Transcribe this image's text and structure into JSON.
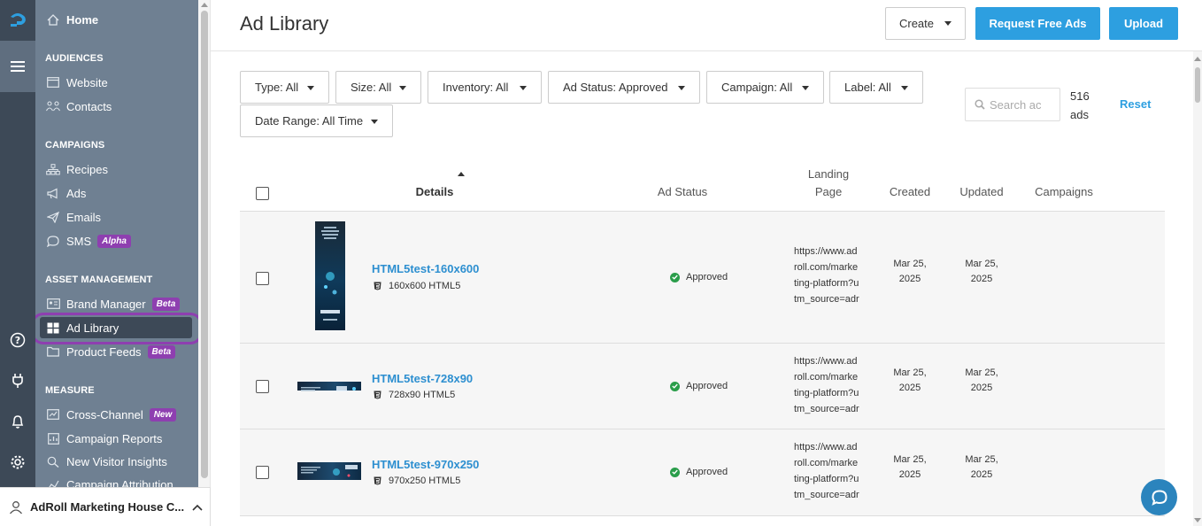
{
  "sidebar": {
    "home": "Home",
    "sections": [
      {
        "title": "AUDIENCES",
        "items": [
          {
            "label": "Website",
            "icon": "browser-icon"
          },
          {
            "label": "Contacts",
            "icon": "contacts-icon"
          }
        ]
      },
      {
        "title": "CAMPAIGNS",
        "items": [
          {
            "label": "Recipes",
            "icon": "recipes-icon"
          },
          {
            "label": "Ads",
            "icon": "megaphone-icon"
          },
          {
            "label": "Emails",
            "icon": "paper-plane-icon"
          },
          {
            "label": "SMS",
            "icon": "chat-bubble-icon",
            "badge": "Alpha"
          }
        ]
      },
      {
        "title": "ASSET MANAGEMENT",
        "items": [
          {
            "label": "Brand Manager",
            "icon": "id-card-icon",
            "badge": "Beta"
          },
          {
            "label": "Ad Library",
            "icon": "grid-icon",
            "active": true
          },
          {
            "label": "Product Feeds",
            "icon": "folder-icon",
            "badge": "Beta"
          }
        ]
      },
      {
        "title": "MEASURE",
        "items": [
          {
            "label": "Cross-Channel",
            "icon": "chart-icon",
            "badge": "New"
          },
          {
            "label": "Campaign Reports",
            "icon": "report-icon"
          },
          {
            "label": "New Visitor Insights",
            "icon": "insights-icon"
          },
          {
            "label": "Campaign Attribution",
            "icon": "attribution-icon"
          }
        ]
      }
    ],
    "account": "AdRoll Marketing House C..."
  },
  "header": {
    "title": "Ad Library",
    "create_label": "Create",
    "request_label": "Request Free Ads",
    "upload_label": "Upload"
  },
  "filters": [
    "Type: All",
    "Size: All",
    "Inventory: All",
    "Ad Status: Approved",
    "Campaign: All",
    "Label: All",
    "Date Range: All Time"
  ],
  "search": {
    "placeholder": "Search ac"
  },
  "ads_count": "516",
  "ads_unit": "ads",
  "reset_label": "Reset",
  "table": {
    "columns": {
      "details": "Details",
      "status": "Ad Status",
      "landing_1": "Landing",
      "landing_2": "Page",
      "created": "Created",
      "updated": "Updated",
      "campaigns": "Campaigns"
    },
    "rows": [
      {
        "name": "HTML5test-160x600",
        "size": "160x600 HTML5",
        "status": "Approved",
        "landing": [
          "https://www.ad",
          "roll.com/marke",
          "ting-platform?u",
          "tm_source=adr"
        ],
        "created": [
          "Mar 25,",
          "2025"
        ],
        "updated": [
          "Mar 25,",
          "2025"
        ]
      },
      {
        "name": "HTML5test-728x90",
        "size": "728x90 HTML5",
        "status": "Approved",
        "landing": [
          "https://www.ad",
          "roll.com/marke",
          "ting-platform?u",
          "tm_source=adr"
        ],
        "created": [
          "Mar 25,",
          "2025"
        ],
        "updated": [
          "Mar 25,",
          "2025"
        ]
      },
      {
        "name": "HTML5test-970x250",
        "size": "970x250 HTML5",
        "status": "Approved",
        "landing": [
          "https://www.ad",
          "roll.com/marke",
          "ting-platform?u",
          "tm_source=adr"
        ],
        "created": [
          "Mar 25,",
          "2025"
        ],
        "updated": [
          "Mar 25,",
          "2025"
        ]
      }
    ]
  },
  "colors": {
    "rail": "#3d4957",
    "nav": "#6f8092",
    "accent": "#2d9fe0",
    "badge": "#8e3fb0",
    "approved": "#2a9d4a"
  }
}
